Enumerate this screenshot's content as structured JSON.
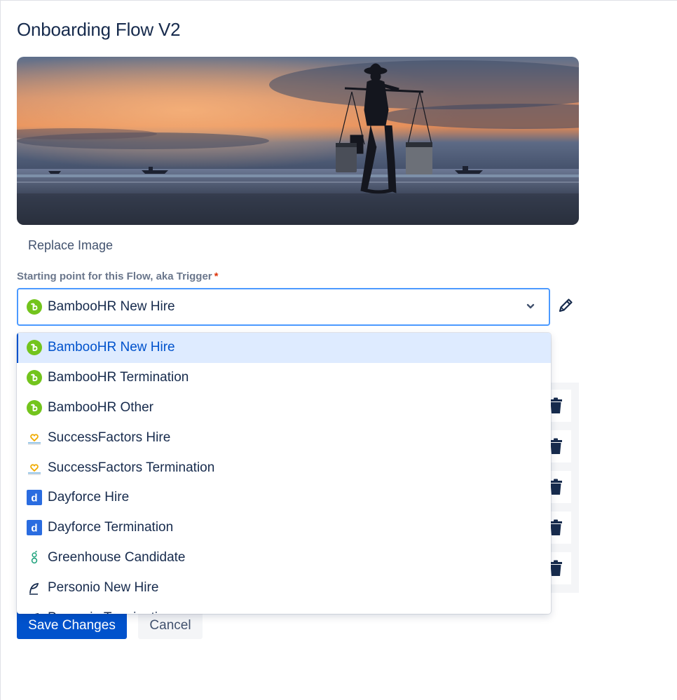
{
  "page": {
    "title": "Onboarding Flow V2"
  },
  "hero": {
    "replace_label": "Replace Image"
  },
  "trigger": {
    "label": "Starting point for this Flow, aka Trigger",
    "required_mark": "*",
    "selected_value": "BambooHR New Hire",
    "selected_icon": "bamboohr-icon"
  },
  "menu": {
    "options": [
      {
        "label": "BambooHR New Hire",
        "icon": "bamboohr-icon",
        "selected": true
      },
      {
        "label": "BambooHR Termination",
        "icon": "bamboohr-icon"
      },
      {
        "label": "BambooHR Other",
        "icon": "bamboohr-icon"
      },
      {
        "label": "SuccessFactors Hire",
        "icon": "successfactors-icon"
      },
      {
        "label": "SuccessFactors Termination",
        "icon": "successfactors-icon"
      },
      {
        "label": "Dayforce Hire",
        "icon": "dayforce-icon"
      },
      {
        "label": "Dayforce Termination",
        "icon": "dayforce-icon"
      },
      {
        "label": "Greenhouse Candidate",
        "icon": "greenhouse-icon"
      },
      {
        "label": "Personio New Hire",
        "icon": "personio-icon"
      },
      {
        "label": "Personio Termination",
        "icon": "personio-icon"
      }
    ]
  },
  "actions": {
    "save_label": "Save Changes",
    "cancel_label": "Cancel"
  },
  "colors": {
    "primary": "#0052cc",
    "focus_border": "#4c9aff",
    "selected_bg": "#deebff",
    "required": "#de350b",
    "bamboohr": "#73c41d",
    "dayforce": "#2a6ce0",
    "greenhouse": "#24a47f",
    "successfactors": "#f0ab00"
  }
}
